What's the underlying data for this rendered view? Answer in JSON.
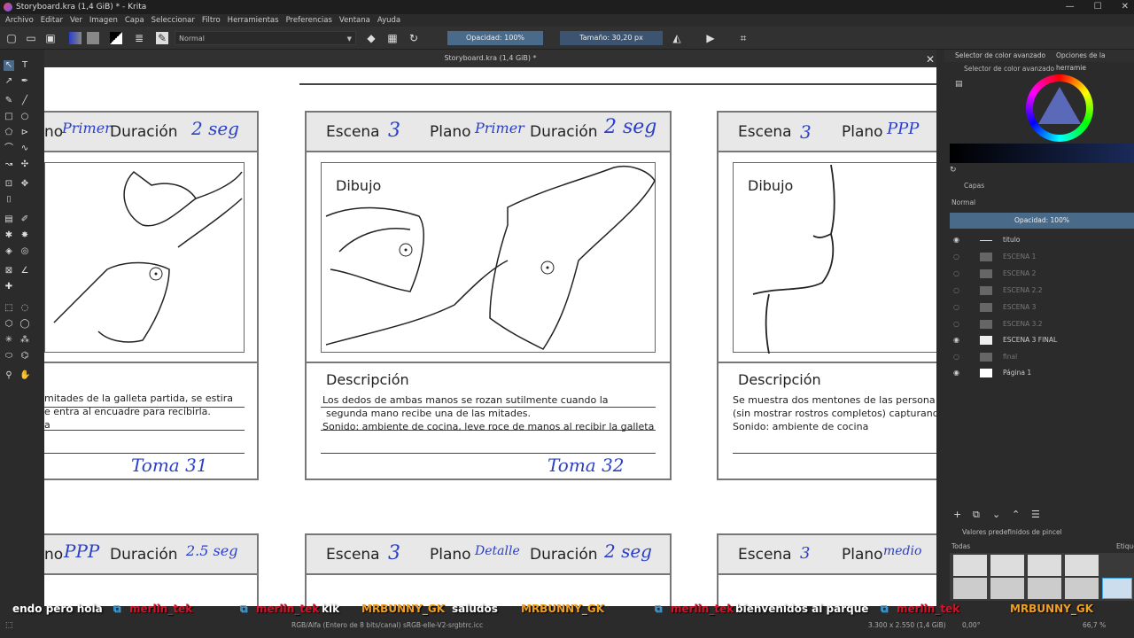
{
  "window": {
    "title": "Storyboard.kra (1,4 GiB) * - Krita"
  },
  "menu": [
    "Archivo",
    "Editar",
    "Ver",
    "Imagen",
    "Capa",
    "Seleccionar",
    "Filtro",
    "Herramientas",
    "Preferencias",
    "Ventana",
    "Ayuda"
  ],
  "toolbar": {
    "blend_mode": "Normal",
    "opacity": "Opacidad: 100%",
    "size": "Tamaño: 30,20 px"
  },
  "document": {
    "tab_title": "Storyboard.kra (1,4 GiB) *"
  },
  "storyboard": {
    "labels": {
      "scene": "Escena",
      "plane": "Plano",
      "duration": "Duración",
      "drawing": "Dibujo",
      "description": "Descripción"
    },
    "panels": [
      {
        "scene_num": "",
        "plane_short": "no",
        "plane": "Primer",
        "duration": "2 seg",
        "description": [
          "mitades de la galleta partida, se estira",
          "e entra al encuadre para recibirla.",
          "a"
        ],
        "shot": "Toma 31"
      },
      {
        "scene_num": "3",
        "plane": "Primer",
        "duration": "2 seg",
        "description": [
          "Los dedos de ambas manos se rozan sutilmente cuando la",
          "segunda mano recibe una de las mitades.",
          "Sonido: ambiente de cocina, leve roce de manos al recibir la galleta"
        ],
        "shot": "Toma 32"
      },
      {
        "scene_num": "3",
        "plane": "PPP",
        "duration": "",
        "description": [
          "Se muestra dos mentones de las persona",
          "(sin mostrar rostros completos) capturand",
          "Sonido: ambiente de cocina"
        ],
        "shot": ""
      }
    ],
    "bottom_panels": [
      {
        "plane_short": "no",
        "plane": "PPP",
        "duration": "2.5 seg"
      },
      {
        "scene_num": "3",
        "plane": "Detalle",
        "duration": "2 seg"
      },
      {
        "scene_num": "3",
        "plane": "medio",
        "duration": ""
      }
    ]
  },
  "dock": {
    "tabs": [
      "Selector de color avanzado",
      "Opciones de la herramie"
    ],
    "color_selector_title": "Selector de color avanzado",
    "layers_title": "Capas",
    "layers_blend": "Normal",
    "layers_opacity": "Opacidad: 100%",
    "layers": [
      {
        "name": "titulo",
        "visible": true
      },
      {
        "name": "ESCENA 1",
        "visible": false
      },
      {
        "name": "ESCENA 2",
        "visible": false
      },
      {
        "name": "ESCENA 2.2",
        "visible": false
      },
      {
        "name": "ESCENA 3",
        "visible": false
      },
      {
        "name": "ESCENA 3.2",
        "visible": false
      },
      {
        "name": "ESCENA 3 FINAL",
        "visible": true
      },
      {
        "name": "final",
        "visible": false
      },
      {
        "name": "Página 1",
        "visible": true
      }
    ],
    "brush_presets_title": "Valores predefinidos de pincel",
    "brush_filter": "Todas",
    "brush_tag_label": "Etique"
  },
  "status": {
    "color_space": "RGB/Alfa (Entero de 8 bits/canal)  sRGB-elle-V2-srgbtrc.icc",
    "dims": "3.300 x 2.550 (1,4 GiB)",
    "rotation": "0,00°",
    "zoom": "66,7 %"
  },
  "chat": [
    {
      "user": "",
      "msg": "endo pero hola"
    },
    {
      "user": "merlin_tek",
      "msg": ""
    },
    {
      "user": "merlin_tek",
      "msg": "klk"
    },
    {
      "user": "MRBUNNY_GK",
      "msg": "saludos"
    },
    {
      "user": "MRBUNNY_GK",
      "msg": ""
    },
    {
      "user": "merlin_tek",
      "msg": "bienvenidos al parque"
    },
    {
      "user": "merlin_tek",
      "msg": ""
    },
    {
      "user": "MRBUNNY_GK",
      "msg": ""
    }
  ]
}
